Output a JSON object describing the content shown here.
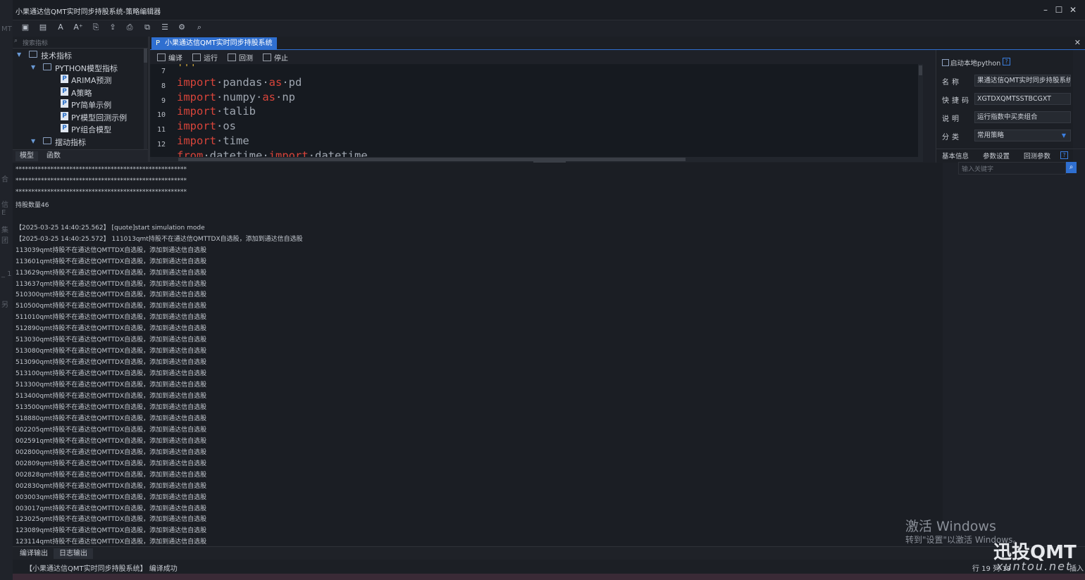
{
  "window": {
    "title": "小果通达信QMT实时同步持股系统-策略编辑器",
    "min_label": "–",
    "max_label": "☐",
    "close_label": "✕"
  },
  "left_strip": [
    "MT",
    "合",
    "信E",
    "集团",
    "_ 1",
    "另"
  ],
  "sidebar": {
    "search_placeholder": "搜索指标",
    "tree": [
      {
        "label": "技术指标",
        "kind": "folder",
        "indent": 0,
        "expanded": true
      },
      {
        "label": "PYTHON模型指标",
        "kind": "folder",
        "indent": 1,
        "expanded": true
      },
      {
        "label": "ARIMA预测",
        "kind": "py",
        "indent": 2
      },
      {
        "label": "A策略",
        "kind": "py",
        "indent": 2
      },
      {
        "label": "PY简单示例",
        "kind": "py",
        "indent": 2
      },
      {
        "label": "PY模型回测示例",
        "kind": "py",
        "indent": 2
      },
      {
        "label": "PY组合模型",
        "kind": "py",
        "indent": 2
      },
      {
        "label": "摆动指标",
        "kind": "folder",
        "indent": 1,
        "expanded": true
      }
    ],
    "tabs": [
      "模型",
      "函数"
    ]
  },
  "editor": {
    "tab_label": "小果通达信QMT实时同步持股系统",
    "tab_icon": "P",
    "actions": [
      "编译",
      "运行",
      "回测",
      "停止"
    ],
    "lines": [
      {
        "num": "7",
        "text": "'''"
      },
      {
        "num": "8",
        "kw1": "import",
        "name": "pandas",
        "kw2": "as",
        "alias": "pd"
      },
      {
        "num": "9",
        "kw1": "import",
        "name": "numpy",
        "kw2": "as",
        "alias": "np"
      },
      {
        "num": "10",
        "kw1": "import",
        "name": "talib",
        "kw2": "",
        "alias": ""
      },
      {
        "num": "11",
        "kw1": "import",
        "name": "os",
        "kw2": "",
        "alias": ""
      },
      {
        "num": "12",
        "kw1": "import",
        "name": "time",
        "kw2": "",
        "alias": ""
      },
      {
        "num": "",
        "kw1": "from",
        "name": "datetime",
        "kw2": "import",
        "alias": "datetime"
      }
    ]
  },
  "properties": {
    "local_python_label": "启动本地python",
    "help": "?",
    "fields": [
      {
        "label": "名称",
        "value": "果通达信QMT实时同步持股系统"
      },
      {
        "label": "快捷码",
        "value": "XGTDXQMTSSTBCGXT"
      },
      {
        "label": "说明",
        "value": "运行指数中买卖组合"
      },
      {
        "label": "分类",
        "value": "常用策略"
      }
    ],
    "tabs": [
      "基本信息",
      "参数设置",
      "回测参数"
    ],
    "keyword_placeholder": "输入关键字"
  },
  "output": {
    "lines": [
      "******************************************************",
      "******************************************************",
      "******************************************************",
      "持股数量46",
      "",
      "【2025-03-25 14:40:25.562】 [quote]start simulation mode",
      "【2025-03-25 14:40:25.572】 111013qmt持股不在通达信QMTTDX自选股，添加到通达信自选股",
      "113039qmt持股不在通达信QMTTDX自选股，添加到通达信自选股",
      "113601qmt持股不在通达信QMTTDX自选股，添加到通达信自选股",
      "113629qmt持股不在通达信QMTTDX自选股，添加到通达信自选股",
      "113637qmt持股不在通达信QMTTDX自选股，添加到通达信自选股",
      "510300qmt持股不在通达信QMTTDX自选股，添加到通达信自选股",
      "510500qmt持股不在通达信QMTTDX自选股，添加到通达信自选股",
      "511010qmt持股不在通达信QMTTDX自选股，添加到通达信自选股",
      "512890qmt持股不在通达信QMTTDX自选股，添加到通达信自选股",
      "513030qmt持股不在通达信QMTTDX自选股，添加到通达信自选股",
      "513080qmt持股不在通达信QMTTDX自选股，添加到通达信自选股",
      "513090qmt持股不在通达信QMTTDX自选股，添加到通达信自选股",
      "513100qmt持股不在通达信QMTTDX自选股，添加到通达信自选股",
      "513300qmt持股不在通达信QMTTDX自选股，添加到通达信自选股",
      "513400qmt持股不在通达信QMTTDX自选股，添加到通达信自选股",
      "513500qmt持股不在通达信QMTTDX自选股，添加到通达信自选股",
      "518880qmt持股不在通达信QMTTDX自选股，添加到通达信自选股",
      "002205qmt持股不在通达信QMTTDX自选股，添加到通达信自选股",
      "002591qmt持股不在通达信QMTTDX自选股，添加到通达信自选股",
      "002800qmt持股不在通达信QMTTDX自选股，添加到通达信自选股",
      "002809qmt持股不在通达信QMTTDX自选股，添加到通达信自选股",
      "002828qmt持股不在通达信QMTTDX自选股，添加到通达信自选股",
      "002830qmt持股不在通达信QMTTDX自选股，添加到通达信自选股",
      "003003qmt持股不在通达信QMTTDX自选股，添加到通达信自选股",
      "003017qmt持股不在通达信QMTTDX自选股，添加到通达信自选股",
      "123025qmt持股不在通达信QMTTDX自选股，添加到通达信自选股",
      "123089qmt持股不在通达信QMTTDX自选股，添加到通达信自选股",
      "123114qmt持股不在通达信QMTTDX自选股，添加到通达信自选股"
    ],
    "tabs": [
      "编译输出",
      "日志输出"
    ]
  },
  "status": {
    "message": "【小果通达信QMT实时同步持股系统】 编译成功",
    "position": "行 19   列 19",
    "mode": "插入"
  },
  "watermark": {
    "line1": "激活 Windows",
    "line2": "转到\"设置\"以激活 Windows。",
    "brand": "迅投QMT",
    "brand_sub": "xuntou.net"
  },
  "colors": {
    "accent": "#2f6fd0",
    "keyword": "#d8443a"
  }
}
